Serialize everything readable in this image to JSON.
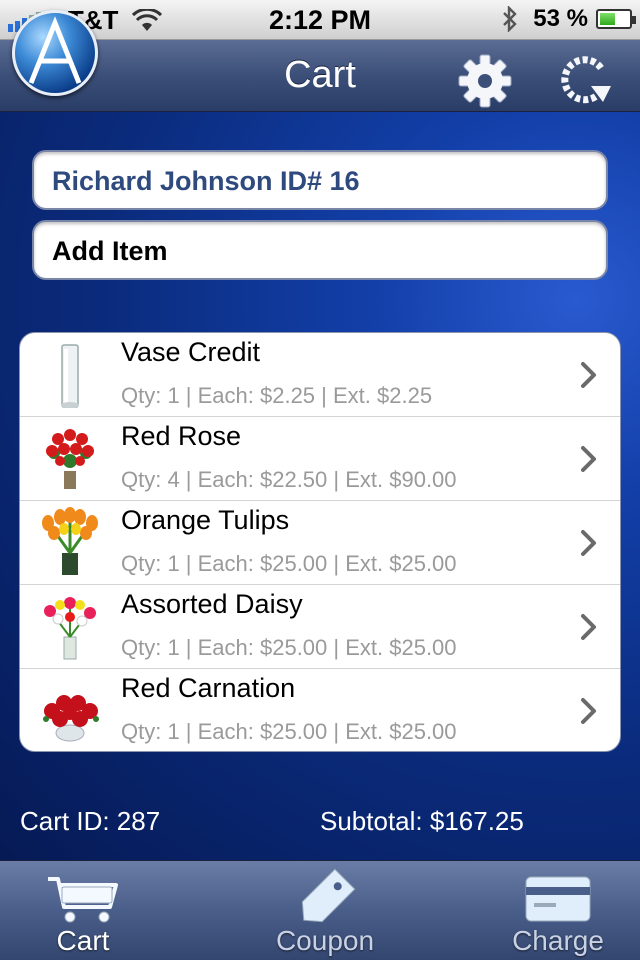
{
  "status_bar": {
    "carrier": "AT&T",
    "time": "2:12 PM",
    "battery_percent": "53 %",
    "battery_level": 0.53
  },
  "nav": {
    "title": "Cart",
    "logo_letter": "A"
  },
  "customer": {
    "label": "Richard Johnson ID# 16"
  },
  "add_item": {
    "label": "Add Item"
  },
  "cart_items": [
    {
      "name": "Vase Credit",
      "detail": "Qty: 1 | Each: $2.25 | Ext.  $2.25",
      "image": "vase"
    },
    {
      "name": "Red Rose",
      "detail": "Qty: 4 | Each: $22.50 | Ext.  $90.00",
      "image": "red-rose"
    },
    {
      "name": "Orange Tulips",
      "detail": "Qty: 1 | Each: $25.00 | Ext.  $25.00",
      "image": "orange-tulips"
    },
    {
      "name": "Assorted Daisy",
      "detail": "Qty: 1 | Each: $25.00 | Ext.  $25.00",
      "image": "assorted-daisy"
    },
    {
      "name": "Red Carnation",
      "detail": "Qty: 1 | Each: $25.00 | Ext.  $25.00",
      "image": "red-carnation"
    }
  ],
  "summary": {
    "cart_id": "Cart ID: 287",
    "subtotal": "Subtotal:  $167.25"
  },
  "tabs": [
    {
      "label": "Cart",
      "icon": "cart-icon",
      "active": true
    },
    {
      "label": "Coupon",
      "icon": "tag-icon",
      "active": false
    },
    {
      "label": "Charge",
      "icon": "credit-card-icon",
      "active": false
    }
  ],
  "colors": {
    "background": "#0a2a7a",
    "nav_bar": "#3c4f78",
    "customer_text": "#2e4a7e",
    "detail_text": "#9a9a9a"
  }
}
